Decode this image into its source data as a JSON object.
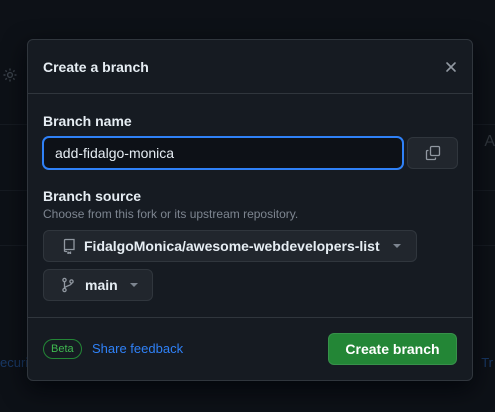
{
  "background": {
    "left_fragment": "ecuri",
    "right_fragment": "Tr",
    "right_letter": "A"
  },
  "dialog": {
    "title": "Create a branch",
    "branch_name_label": "Branch name",
    "branch_name_value": "add-fidalgo-monica",
    "branch_source_label": "Branch source",
    "branch_source_hint": "Choose from this fork or its upstream repository.",
    "repo_selector": "FidalgoMonica/awesome-webdevelopers-list",
    "branch_selector": "main",
    "beta_badge": "Beta",
    "feedback_link": "Share feedback",
    "create_button": "Create branch"
  },
  "colors": {
    "accent_blue": "#2f81f7",
    "primary_green": "#238636",
    "dialog_bg": "#161b22",
    "page_bg": "#0d1117"
  },
  "icons": [
    "gear-icon",
    "close-icon",
    "copy-icon",
    "repo-icon",
    "git-branch-icon",
    "caret-down-icon"
  ]
}
